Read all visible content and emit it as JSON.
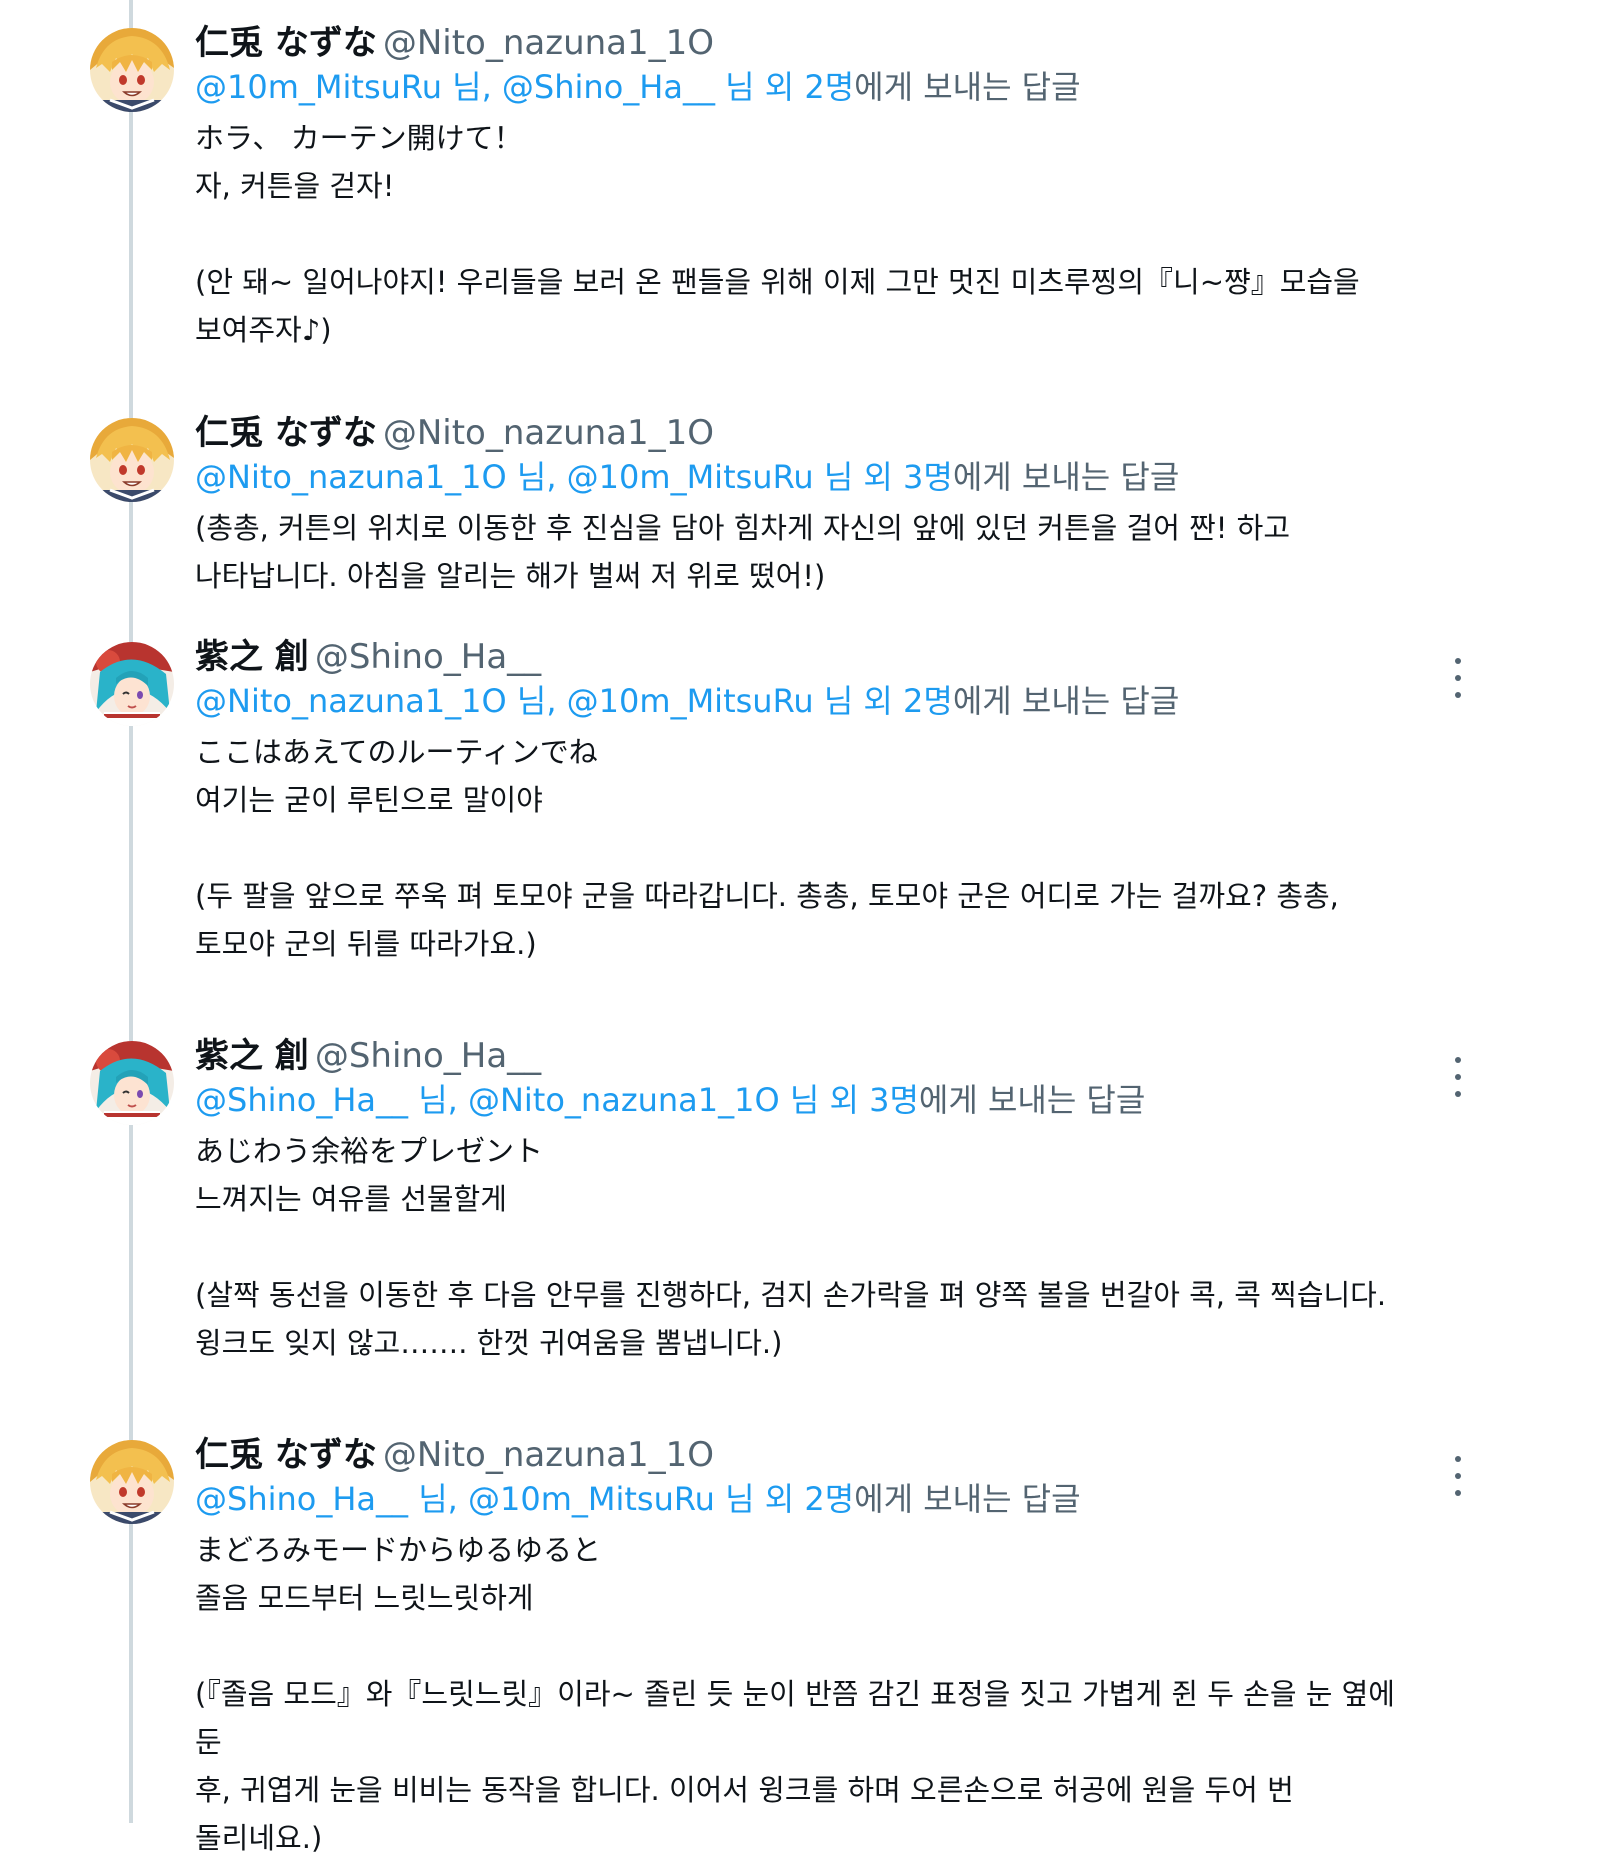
{
  "tweets": [
    {
      "author": "nazuna",
      "display_name": "仁兎 なずな",
      "handle": "@Nito_nazuna1_1O",
      "reply_mentions": "@10m_MitsuRu 님, @Shino_Ha__ 님 외 2명",
      "reply_suffix": "에게 보내는 답글",
      "show_more": false,
      "lines": [
        "ホラ、 カーテン開けて！",
        "자, 커튼을 걷자!",
        "",
        "(안 돼~ 일어나야지! 우리들을 보러 온 팬들을 위해 이제 그만 멋진 미츠루찡의『니~쨩』모습을",
        "보여주자♪)"
      ]
    },
    {
      "author": "nazuna",
      "display_name": "仁兎 なずな",
      "handle": "@Nito_nazuna1_1O",
      "reply_mentions": "@Nito_nazuna1_1O 님, @10m_MitsuRu 님 외 3명",
      "reply_suffix": "에게 보내는 답글",
      "show_more": false,
      "lines": [
        "(총총, 커튼의 위치로 이동한 후 진심을 담아 힘차게 자신의 앞에 있던 커튼을 걸어 짠! 하고",
        "나타납니다. 아침을 알리는 해가 벌써 저 위로 떴어!)"
      ]
    },
    {
      "author": "hajime",
      "display_name": "紫之 創",
      "handle": "@Shino_Ha__",
      "reply_mentions": "@Nito_nazuna1_1O 님, @10m_MitsuRu 님 외 2명",
      "reply_suffix": "에게 보내는 답글",
      "show_more": true,
      "lines": [
        "ここはあえてのルーティンでね",
        "여기는 굳이 루틴으로 말이야",
        "",
        "(두 팔을 앞으로 쭈욱 펴 토모야 군을 따라갑니다. 총총, 토모야 군은 어디로 가는 걸까요? 총총,",
        "토모야 군의 뒤를 따라가요.)"
      ]
    },
    {
      "author": "hajime",
      "display_name": "紫之 創",
      "handle": "@Shino_Ha__",
      "reply_mentions": "@Shino_Ha__ 님, @Nito_nazuna1_1O 님 외 3명",
      "reply_suffix": "에게 보내는 답글",
      "show_more": true,
      "lines": [
        "あじわう余裕をプレゼント",
        "느껴지는 여유를 선물할게",
        "",
        "(살짝 동선을 이동한 후 다음 안무를 진행하다, 검지 손가락을 펴 양쪽 볼을 번갈아 콕, 콕 찍습니다.",
        "윙크도 잊지 않고……. 한껏 귀여움을 뽐냅니다.)"
      ]
    },
    {
      "author": "nazuna",
      "display_name": "仁兎 なずな",
      "handle": "@Nito_nazuna1_1O",
      "reply_mentions": "@Shino_Ha__ 님, @10m_MitsuRu 님 외 2명",
      "reply_suffix": "에게 보내는 답글",
      "show_more": true,
      "lines": [
        "まどろみモードからゆるゆると",
        "졸음 모드부터 느릿느릿하게",
        "",
        "(『졸음 모드』와『느릿느릿』이라~ 졸린 듯 눈이 반쯤 감긴 표정을 짓고 가볍게 쥔 두 손을 눈 옆에 둔",
        "후, 귀엽게 눈을 비비는 동작을 합니다. 이어서 윙크를 하며 오른손으로 허공에 원을 두어 번",
        "돌리네요.)"
      ]
    }
  ],
  "colors": {
    "accent": "#1d9bf0",
    "secondary_text": "#536471",
    "primary_text": "#0f1419",
    "thread_line": "#cfd9de"
  },
  "icons": {
    "more": "more-options-icon"
  }
}
